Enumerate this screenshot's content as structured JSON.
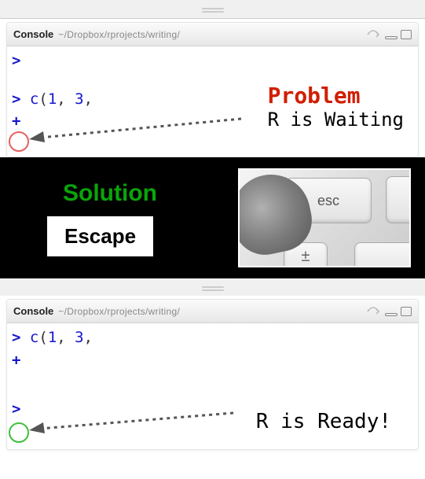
{
  "top_panel": {
    "title": "Console",
    "path": "~/Dropbox/rprojects/writing/",
    "code_line": "> c(1, 3,",
    "continuation": "+"
  },
  "problem": {
    "heading": "Problem",
    "subtitle": "R is Waiting"
  },
  "solution": {
    "heading": "Solution",
    "key_label": "Escape",
    "esc_key_text": "esc",
    "plus_key_text": "±"
  },
  "bottom_panel": {
    "title": "Console",
    "path": "~/Dropbox/rprojects/writing/",
    "code_line": "> c(1, 3,",
    "continuation": "+",
    "prompt": ">"
  },
  "ready": {
    "text": "R is Ready!"
  }
}
